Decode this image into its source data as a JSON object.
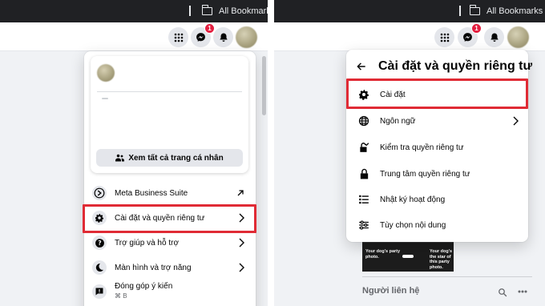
{
  "bookmarks_bar": {
    "label": "All Bookmarks"
  },
  "facebook_bar": {
    "messenger_badge": "1",
    "icons": [
      "menu-grid-icon",
      "messenger-icon",
      "bell-icon",
      "avatar"
    ]
  },
  "left_menu": {
    "profile_card": {
      "see_all_label": "Xem tất cả trang cá nhân"
    },
    "items": [
      {
        "label": "Meta Business Suite",
        "icon": "meta-business-suite-icon",
        "trailing": "external-arrow-icon"
      },
      {
        "label": "Cài đặt và quyền riêng tư",
        "icon": "gear-icon",
        "trailing": "chevron-right-icon",
        "highlighted": true
      },
      {
        "label": "Trợ giúp và hỗ trợ",
        "icon": "help-icon",
        "trailing": "chevron-right-icon"
      },
      {
        "label": "Màn hình và trợ năng",
        "icon": "moon-icon",
        "trailing": "chevron-right-icon"
      },
      {
        "label": "Đóng góp ý kiến",
        "sublabel": "⌘ B",
        "icon": "feedback-icon"
      }
    ]
  },
  "right_menu": {
    "title": "Cài đặt và quyền riêng tư",
    "items": [
      {
        "label": "Cài đặt",
        "icon": "gear-icon",
        "highlighted": true
      },
      {
        "label": "Ngôn ngữ",
        "icon": "globe-icon",
        "trailing": "chevron-right-icon"
      },
      {
        "label": "Kiểm tra quyền riêng tư",
        "icon": "lock-check-icon"
      },
      {
        "label": "Trung tâm quyền riêng tư",
        "icon": "lock-icon"
      },
      {
        "label": "Nhật ký hoạt động",
        "icon": "activity-log-icon"
      },
      {
        "label": "Tùy chọn nội dung",
        "icon": "sliders-icon"
      }
    ]
  },
  "background": {
    "promo_text_left": "Your dog's party photo.",
    "promo_text_right": "Your dog's the star of this party photo.",
    "contacts_heading": "Người liên hệ"
  },
  "colors": {
    "highlight": "#e02b35",
    "messenger_badge": "#e41e3f",
    "bookmarks_bar": "#202124",
    "page_background": "#f0f2f5"
  }
}
